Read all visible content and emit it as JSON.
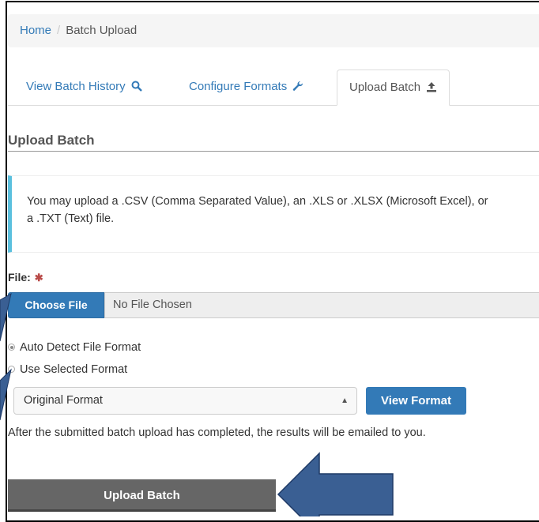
{
  "breadcrumb": {
    "home": "Home",
    "separator": "/",
    "current": "Batch Upload"
  },
  "tabs": [
    {
      "label": "View Batch History",
      "icon": "search-icon"
    },
    {
      "label": "Configure Formats",
      "icon": "wrench-icon"
    },
    {
      "label": "Upload Batch",
      "icon": "upload-icon",
      "active": true
    }
  ],
  "section_title": "Upload Batch",
  "info_text": "You may upload a .CSV (Comma Separated Value), an .XLS or .XLSX (Microsoft Excel), or a .TXT (Text) file.",
  "file": {
    "label": "File:",
    "required_mark": "✱",
    "choose_label": "Choose File",
    "value": "No File Chosen"
  },
  "format_options": [
    {
      "label": "Auto Detect File Format",
      "checked": true
    },
    {
      "label": "Use Selected Format",
      "checked": false
    }
  ],
  "format_select": {
    "selected": "Original Format"
  },
  "view_format_label": "View Format",
  "note": "After the submitted batch upload has completed, the results will be emailed to you.",
  "upload_label": "Upload Batch",
  "colors": {
    "primary": "#337ab7",
    "info_border": "#5bc0de",
    "arrow": "#3a5f93",
    "upload_button": "#666666"
  }
}
